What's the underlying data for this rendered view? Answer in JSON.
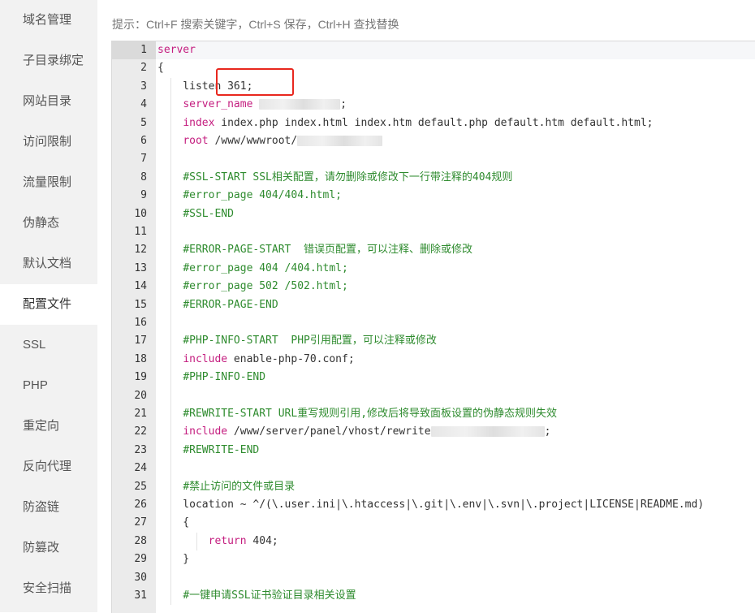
{
  "sidebar": {
    "items": [
      {
        "label": "域名管理"
      },
      {
        "label": "子目录绑定"
      },
      {
        "label": "网站目录"
      },
      {
        "label": "访问限制"
      },
      {
        "label": "流量限制"
      },
      {
        "label": "伪静态"
      },
      {
        "label": "默认文档"
      },
      {
        "label": "配置文件"
      },
      {
        "label": "SSL"
      },
      {
        "label": "PHP"
      },
      {
        "label": "重定向"
      },
      {
        "label": "反向代理"
      },
      {
        "label": "防盗链"
      },
      {
        "label": "防篡改"
      },
      {
        "label": "安全扫描"
      }
    ],
    "active_label": "配置文件"
  },
  "hint": "提示：Ctrl+F 搜索关键字，Ctrl+S 保存，Ctrl+H 查找替换",
  "editor": {
    "lines": [
      {
        "n": "1",
        "segs": [
          {
            "t": "server",
            "c": "dir"
          }
        ]
      },
      {
        "n": "2",
        "segs": [
          {
            "t": "{"
          }
        ]
      },
      {
        "n": "3",
        "segs": [
          {
            "t": "    listen 361;"
          }
        ]
      },
      {
        "n": "4",
        "segs": [
          {
            "t": "    "
          },
          {
            "t": "server_name",
            "c": "dir"
          },
          {
            "t": " "
          },
          {
            "blur": 100
          },
          {
            "t": ";"
          }
        ]
      },
      {
        "n": "5",
        "segs": [
          {
            "t": "    "
          },
          {
            "t": "index",
            "c": "dir"
          },
          {
            "t": " index.php index.html index.htm default.php default.htm default.html;"
          }
        ]
      },
      {
        "n": "6",
        "segs": [
          {
            "t": "    "
          },
          {
            "t": "root",
            "c": "dir"
          },
          {
            "t": " /www/wwwroot/"
          },
          {
            "blur": 105
          }
        ]
      },
      {
        "n": "7",
        "segs": []
      },
      {
        "n": "8",
        "segs": [
          {
            "t": "    "
          },
          {
            "t": "#SSL-START SSL相关配置，请勿删除或修改下一行带注释的404规则",
            "c": "cm"
          }
        ]
      },
      {
        "n": "9",
        "segs": [
          {
            "t": "    "
          },
          {
            "t": "#error_page 404/404.html;",
            "c": "cm"
          }
        ]
      },
      {
        "n": "10",
        "segs": [
          {
            "t": "    "
          },
          {
            "t": "#SSL-END",
            "c": "cm"
          }
        ]
      },
      {
        "n": "11",
        "segs": []
      },
      {
        "n": "12",
        "segs": [
          {
            "t": "    "
          },
          {
            "t": "#ERROR-PAGE-START  错误页配置，可以注释、删除或修改",
            "c": "cm"
          }
        ]
      },
      {
        "n": "13",
        "segs": [
          {
            "t": "    "
          },
          {
            "t": "#error_page 404 /404.html;",
            "c": "cm"
          }
        ]
      },
      {
        "n": "14",
        "segs": [
          {
            "t": "    "
          },
          {
            "t": "#error_page 502 /502.html;",
            "c": "cm"
          }
        ]
      },
      {
        "n": "15",
        "segs": [
          {
            "t": "    "
          },
          {
            "t": "#ERROR-PAGE-END",
            "c": "cm"
          }
        ]
      },
      {
        "n": "16",
        "segs": []
      },
      {
        "n": "17",
        "segs": [
          {
            "t": "    "
          },
          {
            "t": "#PHP-INFO-START  PHP引用配置，可以注释或修改",
            "c": "cm"
          }
        ]
      },
      {
        "n": "18",
        "segs": [
          {
            "t": "    "
          },
          {
            "t": "include",
            "c": "dir"
          },
          {
            "t": " enable-php-70.conf;"
          }
        ]
      },
      {
        "n": "19",
        "segs": [
          {
            "t": "    "
          },
          {
            "t": "#PHP-INFO-END",
            "c": "cm"
          }
        ]
      },
      {
        "n": "20",
        "segs": []
      },
      {
        "n": "21",
        "segs": [
          {
            "t": "    "
          },
          {
            "t": "#REWRITE-START URL重写规则引用,修改后将导致面板设置的伪静态规则失效",
            "c": "cm"
          }
        ]
      },
      {
        "n": "22",
        "segs": [
          {
            "t": "    "
          },
          {
            "t": "include",
            "c": "dir"
          },
          {
            "t": " /www/server/panel/vhost/rewrite"
          },
          {
            "blur": 140
          },
          {
            "t": ";"
          }
        ]
      },
      {
        "n": "23",
        "segs": [
          {
            "t": "    "
          },
          {
            "t": "#REWRITE-END",
            "c": "cm"
          }
        ]
      },
      {
        "n": "24",
        "segs": []
      },
      {
        "n": "25",
        "segs": [
          {
            "t": "    "
          },
          {
            "t": "#禁止访问的文件或目录",
            "c": "cm"
          }
        ]
      },
      {
        "n": "26",
        "segs": [
          {
            "t": "    location ~ ^/(\\.user.ini|\\.htaccess|\\.git|\\.env|\\.svn|\\.project|LICENSE|README.md)"
          }
        ]
      },
      {
        "n": "27",
        "segs": [
          {
            "t": "    {"
          }
        ]
      },
      {
        "n": "28",
        "segs": [
          {
            "t": "        "
          },
          {
            "t": "return",
            "c": "dir"
          },
          {
            "t": " 404;"
          }
        ]
      },
      {
        "n": "29",
        "segs": [
          {
            "t": "    }"
          }
        ]
      },
      {
        "n": "30",
        "segs": []
      },
      {
        "n": "31",
        "segs": [
          {
            "t": "    "
          },
          {
            "t": "#一键申请SSL证书验证目录相关设置",
            "c": "cm"
          }
        ]
      }
    ],
    "active_line": "1"
  },
  "annotation": {
    "color": "#e8271e"
  }
}
